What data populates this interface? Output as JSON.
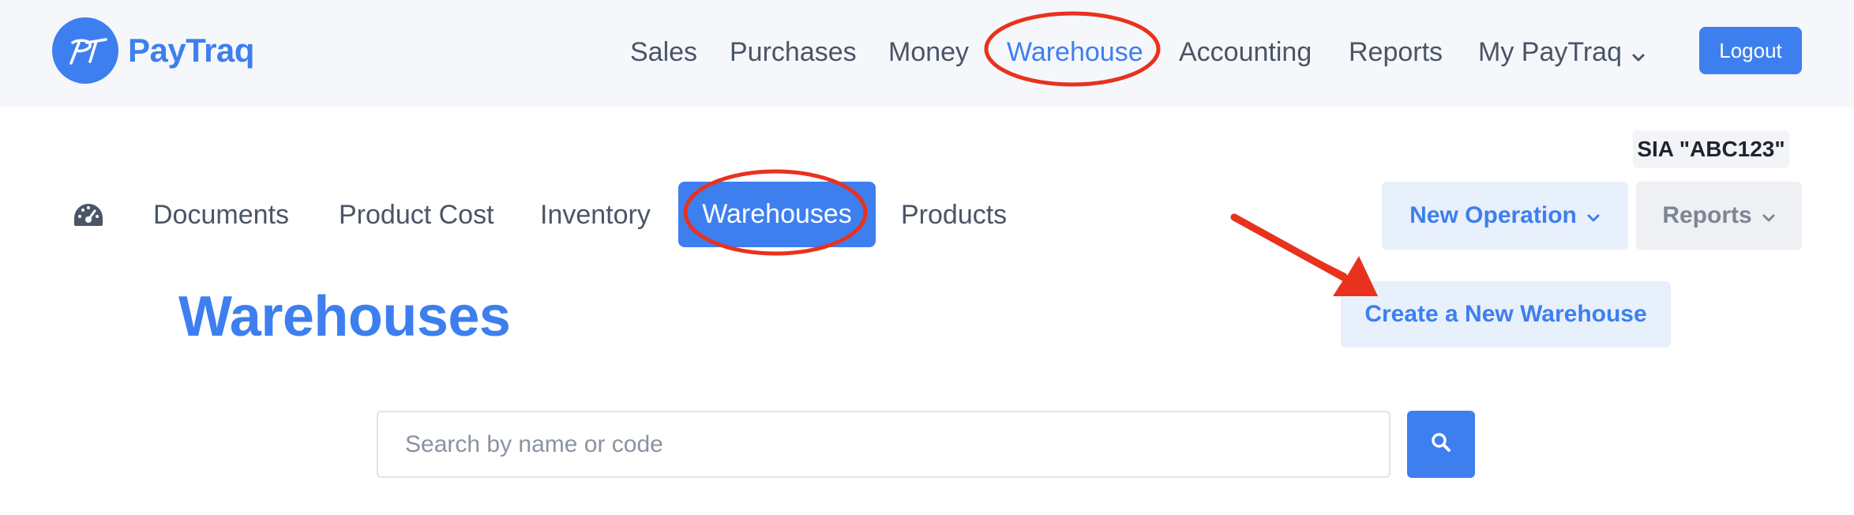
{
  "brand": {
    "name": "PayTraq",
    "logo_monogram": "PT",
    "color": "#3d7fef"
  },
  "topnav": {
    "items": [
      {
        "label": "Sales"
      },
      {
        "label": "Purchases"
      },
      {
        "label": "Money"
      },
      {
        "label": "Warehouse",
        "active": true
      },
      {
        "label": "Accounting"
      },
      {
        "label": "Reports"
      },
      {
        "label": "My PayTraq",
        "has_dropdown": true
      }
    ],
    "logout_label": "Logout"
  },
  "company": {
    "name": "SIA \"ABC123\""
  },
  "subnav": {
    "dashboard_icon": "dashboard-gauge-icon",
    "items": [
      {
        "label": "Documents"
      },
      {
        "label": "Product Cost"
      },
      {
        "label": "Inventory"
      },
      {
        "label": "Warehouses",
        "active": true
      },
      {
        "label": "Products"
      }
    ],
    "new_operation_label": "New Operation",
    "reports_label": "Reports"
  },
  "main": {
    "title": "Warehouses",
    "create_button_label": "Create a New Warehouse",
    "search": {
      "placeholder": "Search by name or code",
      "value": "",
      "button_icon": "search-icon"
    }
  },
  "annotations": {
    "highlight_color": "#e8321e"
  }
}
